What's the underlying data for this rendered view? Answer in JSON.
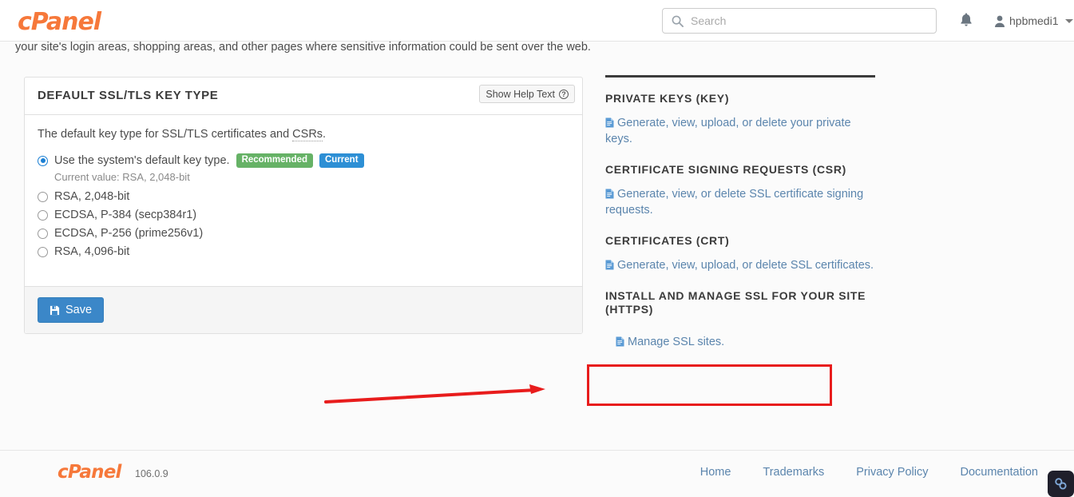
{
  "header": {
    "logo_text": "cPanel",
    "search": {
      "placeholder": "Search",
      "value": ""
    },
    "notifications_icon": "bell-icon",
    "user": {
      "name": "hpbmedi1",
      "icon": "user-icon",
      "caret": "chevron-down-icon"
    }
  },
  "intro": {
    "text": "your site's login areas, shopping areas, and other pages where sensitive information could be sent over the web."
  },
  "panel": {
    "title": "DEFAULT SSL/TLS KEY TYPE",
    "help_button": {
      "label": "Show Help Text",
      "icon": "question-circle-icon"
    },
    "description_prefix": "The default key type for SSL/TLS certificates and ",
    "description_abbr": "CSRs",
    "description_suffix": ".",
    "options": [
      {
        "label": "Use the system's default key type.",
        "checked": true,
        "badges": [
          {
            "text": "Recommended",
            "color": "#66b266"
          },
          {
            "text": "Current",
            "color": "#2d8fd5"
          }
        ],
        "sub_text": "Current value: RSA, 2,048-bit"
      },
      {
        "label": "RSA, 2,048-bit",
        "checked": false,
        "badges": [],
        "sub_text": ""
      },
      {
        "label": "ECDSA, P-384 (secp384r1)",
        "checked": false,
        "badges": [],
        "sub_text": ""
      },
      {
        "label": "ECDSA, P-256 (prime256v1)",
        "checked": false,
        "badges": [],
        "sub_text": ""
      },
      {
        "label": "RSA, 4,096-bit",
        "checked": false,
        "badges": [],
        "sub_text": ""
      }
    ],
    "save_button": {
      "label": "Save",
      "icon": "floppy-disk-icon",
      "color": "#3b87c8"
    }
  },
  "sidebar": {
    "sections": [
      {
        "title": "PRIVATE KEYS (KEY)",
        "link": "Generate, view, upload, or delete your private keys.",
        "link_icon": "document-icon"
      },
      {
        "title": "CERTIFICATE SIGNING REQUESTS (CSR)",
        "link": "Generate, view, or delete SSL certificate signing requests.",
        "link_icon": "document-icon"
      },
      {
        "title": "CERTIFICATES (CRT)",
        "link": "Generate, view, upload, or delete SSL certificates.",
        "link_icon": "document-icon"
      },
      {
        "title": "INSTALL AND MANAGE SSL FOR YOUR SITE (HTTPS)",
        "link": "Manage SSL sites.",
        "link_icon": "document-icon",
        "highlighted": true
      }
    ],
    "link_color": "#5b85ad"
  },
  "annotations": {
    "box_color": "#e81c1c",
    "arrow_color": "#e81c1c"
  },
  "footer": {
    "logo_text": "cPanel",
    "version": "106.0.9",
    "links": [
      "Home",
      "Trademarks",
      "Privacy Policy",
      "Documentation"
    ],
    "float_button_icon": "chain-link-icon"
  }
}
